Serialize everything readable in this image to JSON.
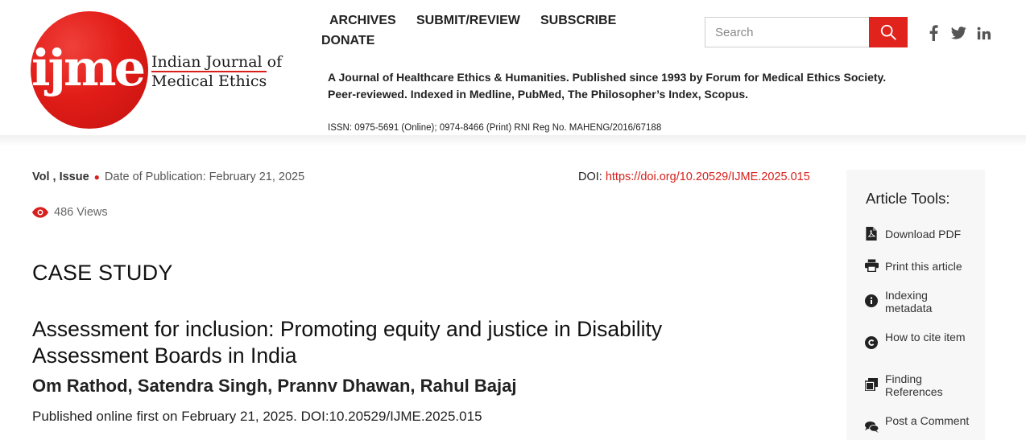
{
  "brand": {
    "logo_mark": "ijme",
    "name_line1": "Indian Journal of",
    "name_line2": "Medical Ethics",
    "accent_color": "#e0231c"
  },
  "nav": {
    "items": [
      {
        "label": "ARCHIVES"
      },
      {
        "label": "SUBMIT/REVIEW"
      },
      {
        "label": "SUBSCRIBE"
      },
      {
        "label": "DONATE"
      }
    ]
  },
  "search": {
    "placeholder": "Search",
    "button_icon": "search-icon"
  },
  "social": [
    {
      "icon": "facebook-icon"
    },
    {
      "icon": "twitter-icon"
    },
    {
      "icon": "linkedin-icon"
    }
  ],
  "tagline": {
    "line1": "A Journal of Healthcare Ethics & Humanities. Published since 1993 by Forum for Medical Ethics Society.",
    "line2": "Peer-reviewed. Indexed in Medline, PubMed, The Philosopher’s Index, Scopus."
  },
  "issn": "ISSN: 0975-5691 (Online); 0974-8466 (Print) RNI Reg No. MAHENG/2016/67188",
  "article": {
    "vol_issue": "Vol , Issue",
    "date_of_publication": "Date of Publication: February 21, 2025",
    "doi_label": "DOI: ",
    "doi_link": "https://doi.org/10.20529/IJME.2025.015",
    "views": "486 Views",
    "section": "CASE STUDY",
    "title": "Assessment for inclusion: Promoting equity and justice in Disability Assessment Boards in India",
    "authors": "Om Rathod, Satendra Singh, Prannv Dhawan, Rahul Bajaj",
    "published_line": "Published online first on February 21, 2025. DOI:10.20529/IJME.2025.015"
  },
  "tools": {
    "title": "Article Tools:",
    "items": [
      {
        "label": "Download PDF",
        "icon": "pdf-file-icon"
      },
      {
        "label": "Print this article",
        "icon": "printer-icon"
      },
      {
        "label": "Indexing metadata",
        "icon": "info-icon"
      },
      {
        "label": "How to cite item",
        "icon": "copyright-icon"
      },
      {
        "label": "Finding References",
        "icon": "documents-icon"
      },
      {
        "label": "Post a Comment",
        "icon": "comment-icon"
      }
    ]
  }
}
